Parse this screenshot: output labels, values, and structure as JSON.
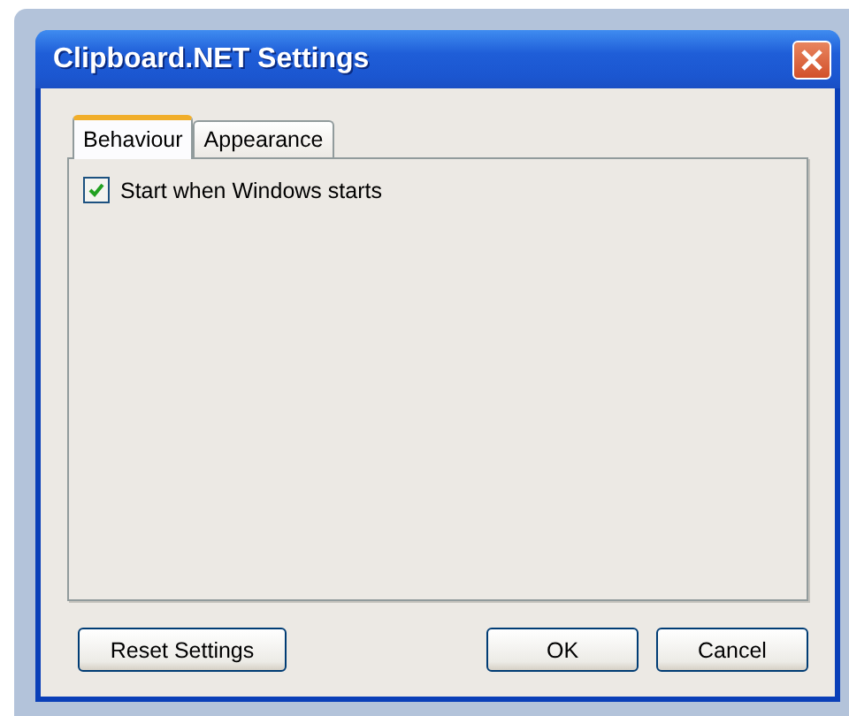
{
  "window": {
    "title": "Clipboard.NET Settings"
  },
  "tabs": [
    {
      "label": "Behaviour",
      "selected": true
    },
    {
      "label": "Appearance",
      "selected": false
    }
  ],
  "options": [
    {
      "label": "Start when Windows starts",
      "checked": true
    }
  ],
  "buttons": [
    {
      "label": "Reset Settings",
      "kind": "left"
    },
    {
      "label": "OK",
      "kind": "right"
    },
    {
      "label": "Cancel",
      "kind": "right"
    }
  ]
}
